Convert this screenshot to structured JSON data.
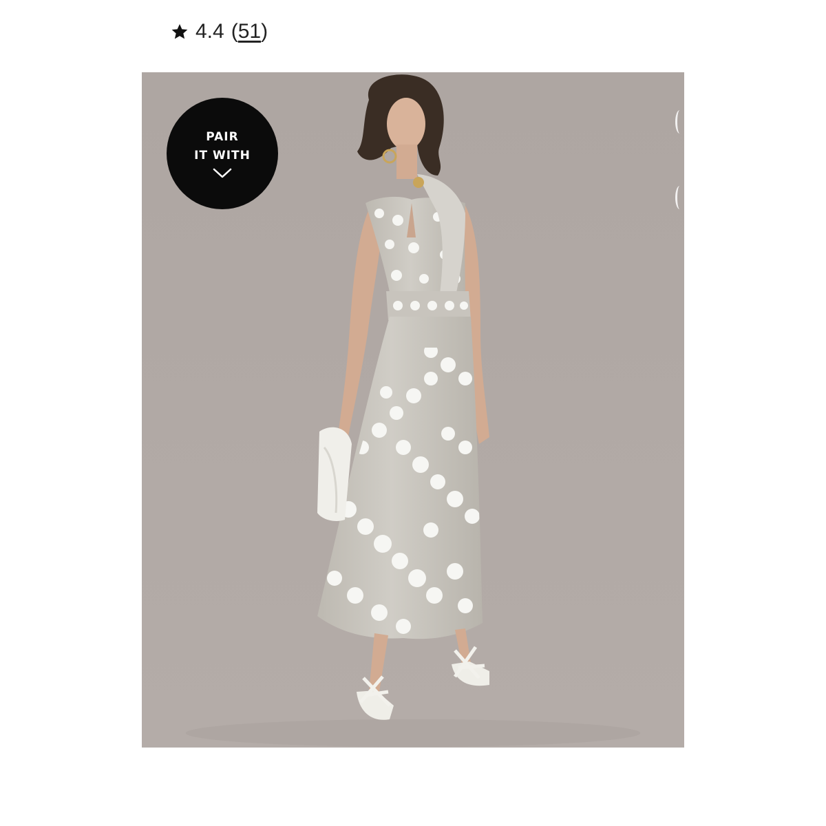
{
  "rating": {
    "icon": "star-icon",
    "value": "4.4",
    "open_paren": "(",
    "count": "51",
    "close_paren": ")"
  },
  "product_image": {
    "background_color": "#b0a7a3",
    "dress_color": "#c9c6bf",
    "dot_color": "#f7f7f5"
  },
  "pair_badge": {
    "line1": "PAIR",
    "line2": "IT WITH",
    "icon": "chevron-down-icon",
    "background_color": "#0b0b0b"
  }
}
